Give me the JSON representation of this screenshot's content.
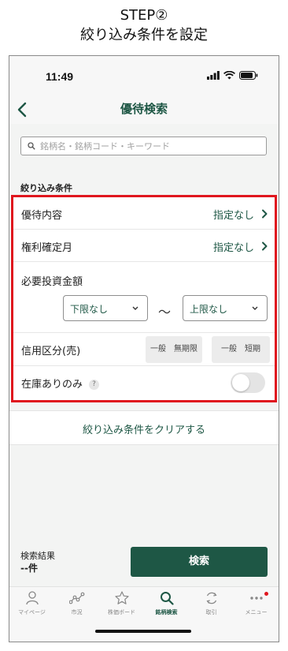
{
  "caption": {
    "line1": "STEP②",
    "line2": "絞り込み条件を設定"
  },
  "status_bar": {
    "time": "11:49"
  },
  "nav": {
    "title": "優待検索"
  },
  "search": {
    "placeholder": "銘柄名・銘柄コード・キーワード"
  },
  "filters": {
    "section_label": "絞り込み条件",
    "yutai_content": {
      "label": "優待内容",
      "value": "指定なし"
    },
    "kenri_month": {
      "label": "権利確定月",
      "value": "指定なし"
    },
    "investment": {
      "label": "必要投資金額",
      "lower": "下限なし",
      "separator": "〜",
      "upper": "上限なし"
    },
    "credit": {
      "label": "信用区分(売)",
      "option1": "一般　無期限",
      "option2": "一般　短期"
    },
    "stock_only": {
      "label": "在庫ありのみ",
      "help": "?",
      "enabled": false
    }
  },
  "clear_label": "絞り込み条件をクリアする",
  "result": {
    "label": "検索結果",
    "count": "--件",
    "search_button": "検索"
  },
  "tabs": [
    {
      "label": "マイページ",
      "icon": "person-icon"
    },
    {
      "label": "市況",
      "icon": "market-graph-icon"
    },
    {
      "label": "株価ボード",
      "icon": "star-icon"
    },
    {
      "label": "銘柄検索",
      "icon": "search-icon",
      "active": true
    },
    {
      "label": "取引",
      "icon": "trade-cycle-icon"
    },
    {
      "label": "メニュー",
      "icon": "more-dots-icon"
    }
  ],
  "colors": {
    "accent": "#1e5745",
    "highlight_border": "#e0161e",
    "notification_dot": "#e0161e"
  }
}
